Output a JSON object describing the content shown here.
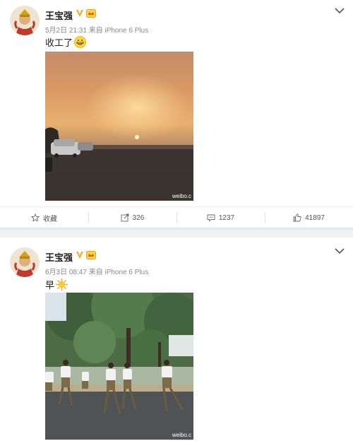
{
  "posts": [
    {
      "username": "王宝强",
      "meta": "5月2日 21:31 来自 iPhone 6 Plus",
      "text": "收工了",
      "emoji": "grinning-emoji",
      "watermark": "weibo.c",
      "actions": {
        "favorite_label": "收藏",
        "repost_count": "326",
        "comment_count": "1237",
        "like_count": "41897"
      }
    },
    {
      "username": "王宝强",
      "meta": "6月3日 08:47 来自 iPhone 6 Plus",
      "text": "早",
      "emoji": "sun-emoji",
      "watermark": "weibo.c"
    }
  ],
  "colors": {
    "vip_badge": "#f5a623",
    "separator": "#d6eef6",
    "text_secondary": "#8a8a8a"
  }
}
